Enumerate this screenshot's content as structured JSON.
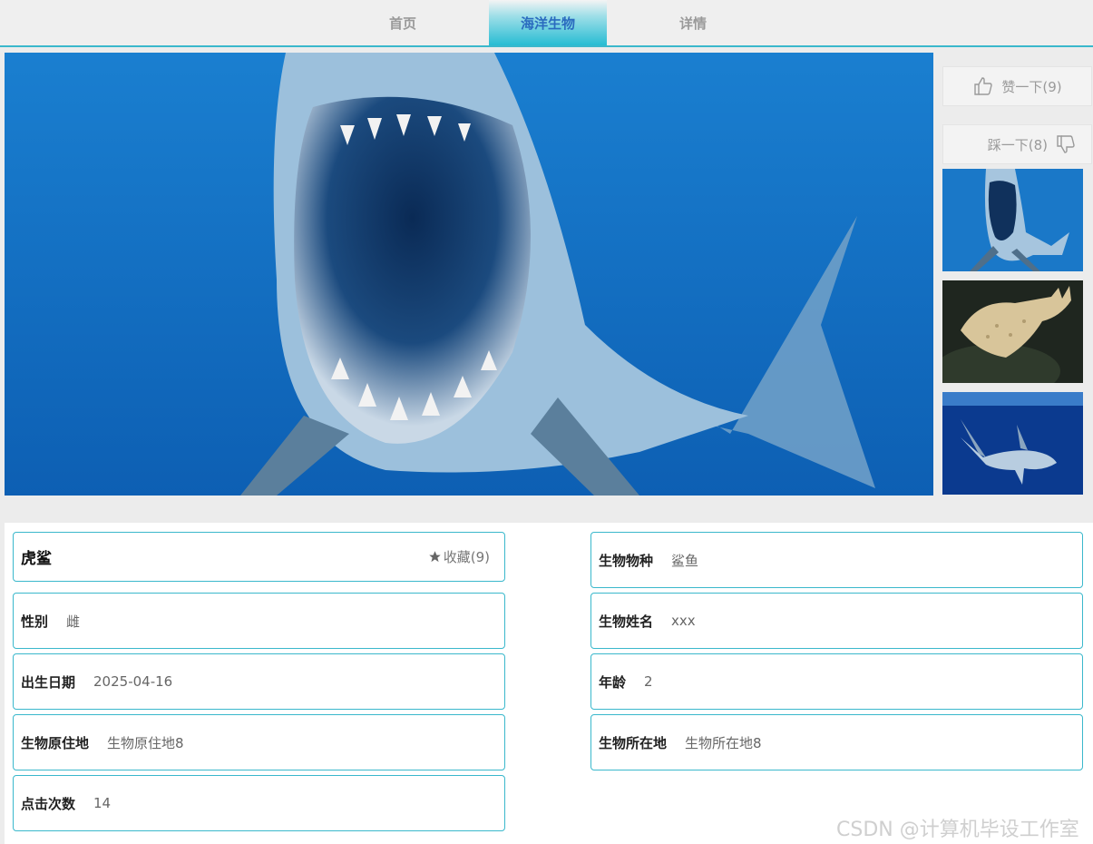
{
  "nav": {
    "items": [
      {
        "label": "首页"
      },
      {
        "label": "海洋生物",
        "active": true
      },
      {
        "label": "详情"
      }
    ],
    "accent_color": "#27bcd3"
  },
  "hero": {
    "image": "great-white-shark-open-mouth"
  },
  "votes": {
    "like_label": "赞一下(9)",
    "dislike_label": "踩一下(8)"
  },
  "thumbnails": [
    "shark",
    "guitarfish",
    "shark"
  ],
  "detail": {
    "name": "虎鲨",
    "favorite_label": "收藏(9)",
    "left": [
      {
        "label": "性别",
        "value": "雌"
      },
      {
        "label": "出生日期",
        "value": "2025-04-16"
      },
      {
        "label": "生物原住地",
        "value": "生物原住地8"
      },
      {
        "label": "点击次数",
        "value": "14"
      }
    ],
    "right": [
      {
        "label": "生物物种",
        "value": "鲨鱼"
      },
      {
        "label": "生物姓名",
        "value": "xxx"
      },
      {
        "label": "年龄",
        "value": "2"
      },
      {
        "label": "生物所在地",
        "value": "生物所在地8"
      }
    ]
  },
  "watermark": "CSDN @计算机毕设工作室"
}
